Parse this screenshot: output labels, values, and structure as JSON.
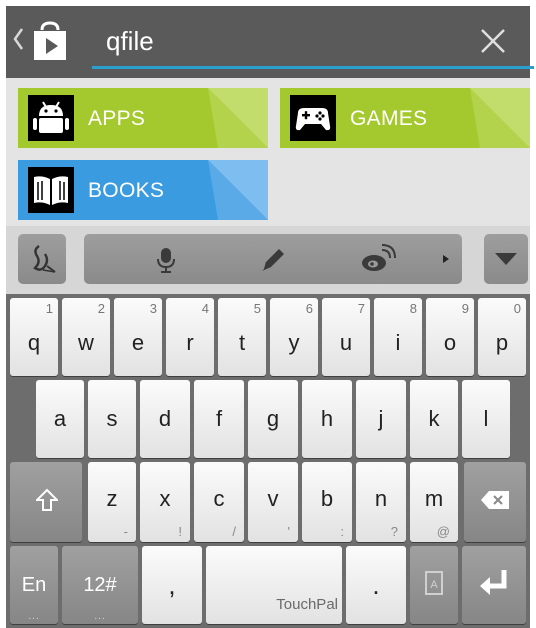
{
  "search": {
    "query": "qfile"
  },
  "categories": {
    "apps_label": "APPS",
    "games_label": "GAMES",
    "books_label": "BOOKS"
  },
  "colors": {
    "search_bar": "#5a5a5a",
    "search_underline": "#2a9fd0",
    "apps_tile": "#a4c92e",
    "games_tile": "#a4c92e",
    "books_tile": "#3b9be0",
    "keyboard_bg": "#6d6d6d"
  },
  "toolbar": {
    "icons": [
      "handwriting-icon",
      "microphone-icon",
      "pencil-icon",
      "weibo-icon",
      "expand-arrow-icon",
      "hide-keyboard-icon"
    ]
  },
  "keyboard": {
    "row1": [
      {
        "key": "q",
        "num": "1"
      },
      {
        "key": "w",
        "num": "2"
      },
      {
        "key": "e",
        "num": "3"
      },
      {
        "key": "r",
        "num": "4"
      },
      {
        "key": "t",
        "num": "5"
      },
      {
        "key": "y",
        "num": "6"
      },
      {
        "key": "u",
        "num": "7"
      },
      {
        "key": "i",
        "num": "8"
      },
      {
        "key": "o",
        "num": "9"
      },
      {
        "key": "p",
        "num": "0"
      }
    ],
    "row2": [
      "a",
      "s",
      "d",
      "f",
      "g",
      "h",
      "j",
      "k",
      "l"
    ],
    "row3": [
      {
        "key": "z",
        "sub": "-"
      },
      {
        "key": "x",
        "sub": "!"
      },
      {
        "key": "c",
        "sub": "/"
      },
      {
        "key": "v",
        "sub": "'"
      },
      {
        "key": "b",
        "sub": ":"
      },
      {
        "key": "n",
        "sub": "?"
      },
      {
        "key": "m",
        "sub": "@"
      }
    ],
    "lang_label": "En",
    "symbols_label": "12#",
    "comma_label": ",",
    "space_label": "TouchPal",
    "period_label": ".",
    "more_dots": "..."
  }
}
